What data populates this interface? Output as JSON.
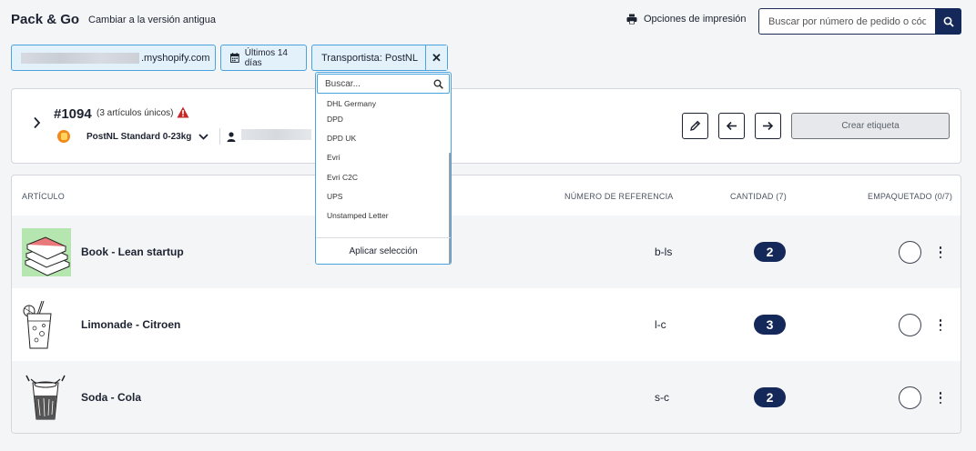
{
  "header": {
    "app_title": "Pack & Go",
    "old_version_link": "Cambiar a la versión antigua",
    "print_options": "Opciones de impresión",
    "search_placeholder": "Buscar por número de pedido o código",
    "icons": {
      "print": "printer-icon",
      "search": "search-icon"
    }
  },
  "filters": {
    "store_suffix": ".myshopify.com",
    "date_range": "Últimos 14 días",
    "carrier": "Transportista: PostNL"
  },
  "carrier_dropdown": {
    "search_placeholder": "Buscar...",
    "options": [
      "DHL Germany",
      "DPD",
      "DPD UK",
      "Evri",
      "Evri C2C",
      "UPS",
      "Unstamped Letter"
    ],
    "apply_label": "Aplicar selección"
  },
  "order": {
    "number": "#1094",
    "unique_items": "(3 artículos únicos)",
    "shipping_service": "PostNL Standard 0-23kg",
    "create_label": "Crear etiqueta",
    "warning_color": "#c62828"
  },
  "items_table": {
    "headers": {
      "article": "ARTÍCULO",
      "reference": "NÚMERO DE REFERENCIA",
      "quantity": "CANTIDAD (7)",
      "packed": "EMPAQUETADO (0/7)"
    },
    "rows": [
      {
        "name": "Book - Lean startup",
        "reference": "b-ls",
        "quantity": "2"
      },
      {
        "name": "Limonade - Citroen",
        "reference": "l-c",
        "quantity": "3"
      },
      {
        "name": "Soda - Cola",
        "reference": "s-c",
        "quantity": "2"
      }
    ]
  },
  "colors": {
    "accent": "#14295a",
    "chip_bg": "#e3f1fb",
    "chip_border": "#4aa3df"
  }
}
